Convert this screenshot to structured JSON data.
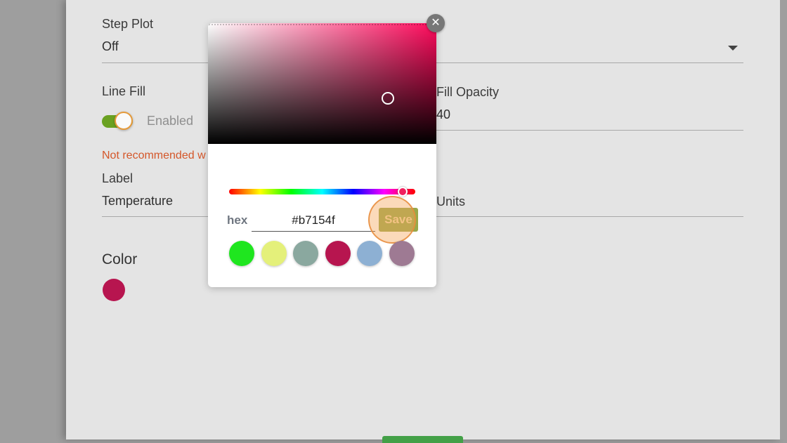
{
  "form": {
    "step_plot": {
      "label": "Step Plot",
      "value": "Off"
    },
    "line_fill": {
      "label": "Line Fill",
      "toggle_text": "Enabled",
      "enabled": true
    },
    "fill_opacity": {
      "label": "Fill Opacity",
      "value": "40"
    },
    "warning": "Not recommended w",
    "label_field": {
      "label": "Label",
      "value": "Temperature"
    },
    "units_field": {
      "value": "Units"
    },
    "color_section": {
      "title": "Color",
      "current_color": "#b7154f"
    }
  },
  "color_picker": {
    "hue_color": "#ff0a5c",
    "hex_label": "hex",
    "hex_value": "#b7154f",
    "save_label": "Save",
    "close_glyph": "✕",
    "swatches": [
      "#1fe61f",
      "#e4f07a",
      "#8aa89f",
      "#b7154f",
      "#8db0d3",
      "#9e7a93"
    ]
  },
  "colors": {
    "toggle_active": "#6aa121",
    "warning": "#d4572a",
    "primary_button": "#43a047"
  }
}
